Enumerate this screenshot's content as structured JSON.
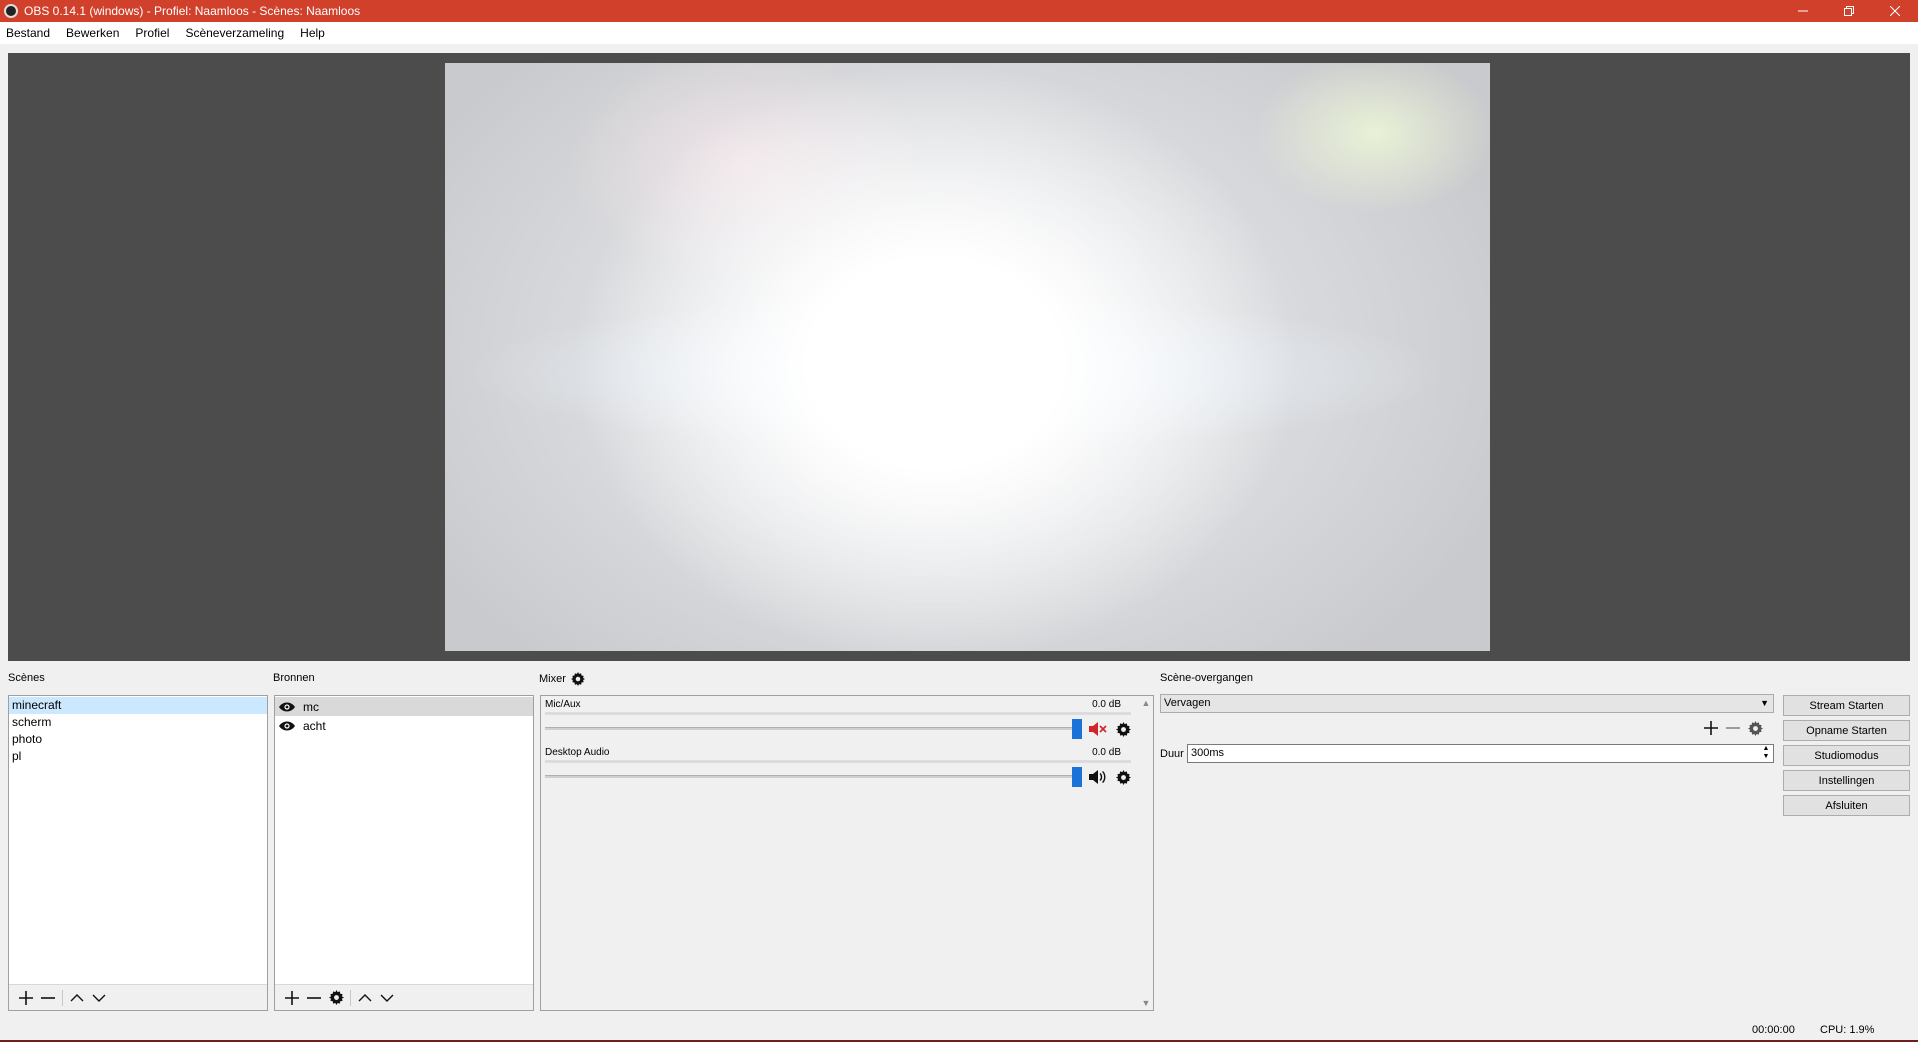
{
  "window": {
    "title": "OBS 0.14.1 (windows) - Profiel: Naamloos - Scènes: Naamloos",
    "controls": [
      "minimize-icon",
      "restore-icon",
      "close-icon"
    ]
  },
  "menu": [
    "Bestand",
    "Bewerken",
    "Profiel",
    "Scèneverzameling",
    "Help"
  ],
  "docks": {
    "scenes_label": "Scènes",
    "sources_label": "Bronnen",
    "mixer_label": "Mixer",
    "transitions_label": "Scène-overgangen"
  },
  "scenes": [
    "minecraft",
    "scherm",
    "photo",
    "pl"
  ],
  "selected_scene": "minecraft",
  "sources": [
    "mc",
    "acht"
  ],
  "selected_source": "mc",
  "mixer": {
    "tracks": [
      {
        "name": "Mic/Aux",
        "db": "0.0 dB",
        "muted": true
      },
      {
        "name": "Desktop Audio",
        "db": "0.0 dB",
        "muted": false
      }
    ]
  },
  "transitions": {
    "selected": "Vervagen",
    "duration_label": "Duur",
    "duration_value": "300ms"
  },
  "controls": [
    "Stream Starten",
    "Opname Starten",
    "Studiomodus",
    "Instellingen",
    "Afsluiten"
  ],
  "status": {
    "time": "00:00:00",
    "cpu": "CPU: 1.9%"
  },
  "colors": {
    "titlebar": "#d0402b",
    "preview_bg": "#4c4c4c",
    "slider_handle": "#1a73d9",
    "mute_red": "#d0252b",
    "selection": "#cce8ff"
  }
}
